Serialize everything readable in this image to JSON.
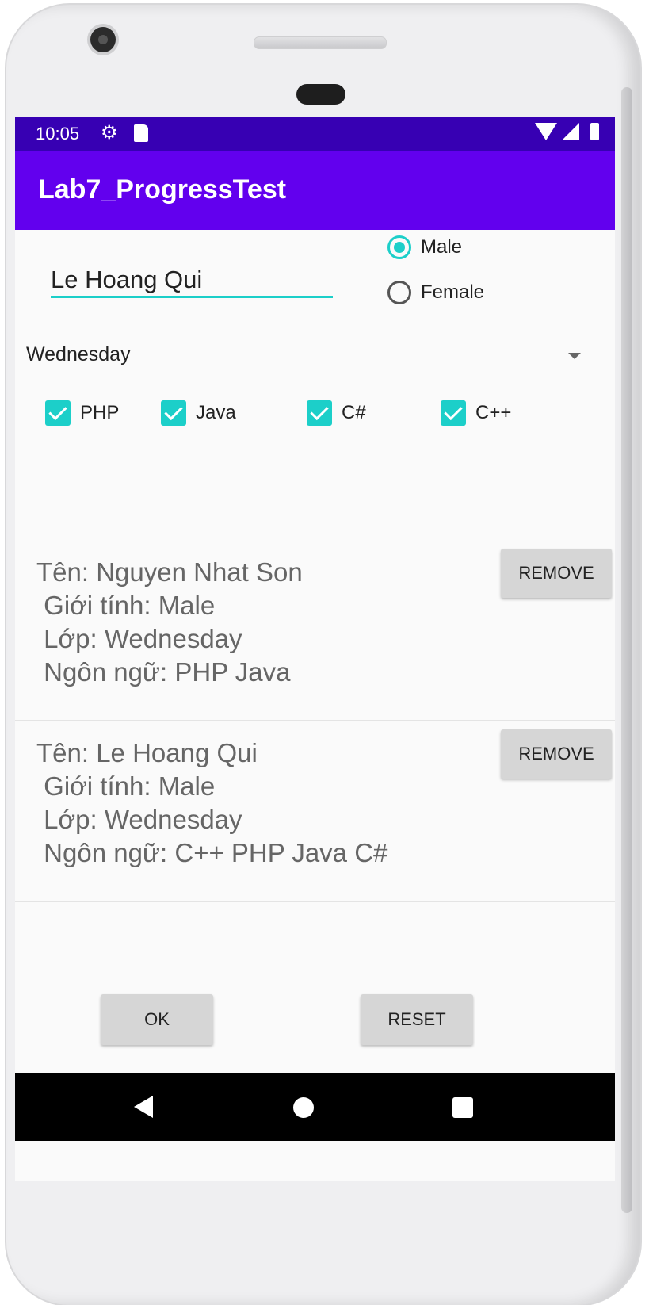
{
  "status_bar": {
    "time": "10:05"
  },
  "app_bar": {
    "title": "Lab7_ProgressTest"
  },
  "form": {
    "name_value": "Le Hoang Qui",
    "gender_options": [
      {
        "label": "Male",
        "checked": true
      },
      {
        "label": "Female",
        "checked": false
      }
    ],
    "day_select": {
      "selected": "Wednesday"
    },
    "languages": [
      {
        "label": "PHP",
        "checked": true
      },
      {
        "label": "Java",
        "checked": true
      },
      {
        "label": "C#",
        "checked": true
      },
      {
        "label": "C++",
        "checked": true
      }
    ]
  },
  "entries": [
    {
      "name_line": "Tên: Nguyen Nhat Son",
      "gender_line": " Giới tính: Male",
      "class_line": " Lớp: Wednesday",
      "lang_line": " Ngôn ngữ: PHP Java",
      "remove_label": "REMOVE"
    },
    {
      "name_line": "Tên: Le Hoang Qui",
      "gender_line": " Giới tính: Male",
      "class_line": " Lớp: Wednesday",
      "lang_line": " Ngôn ngữ: C++ PHP Java C#",
      "remove_label": "REMOVE"
    }
  ],
  "actions": {
    "ok_label": "OK",
    "reset_label": "RESET"
  },
  "colors": {
    "status_bar": "#3700b3",
    "app_bar": "#6200ee",
    "accent": "#1ccfc9"
  }
}
